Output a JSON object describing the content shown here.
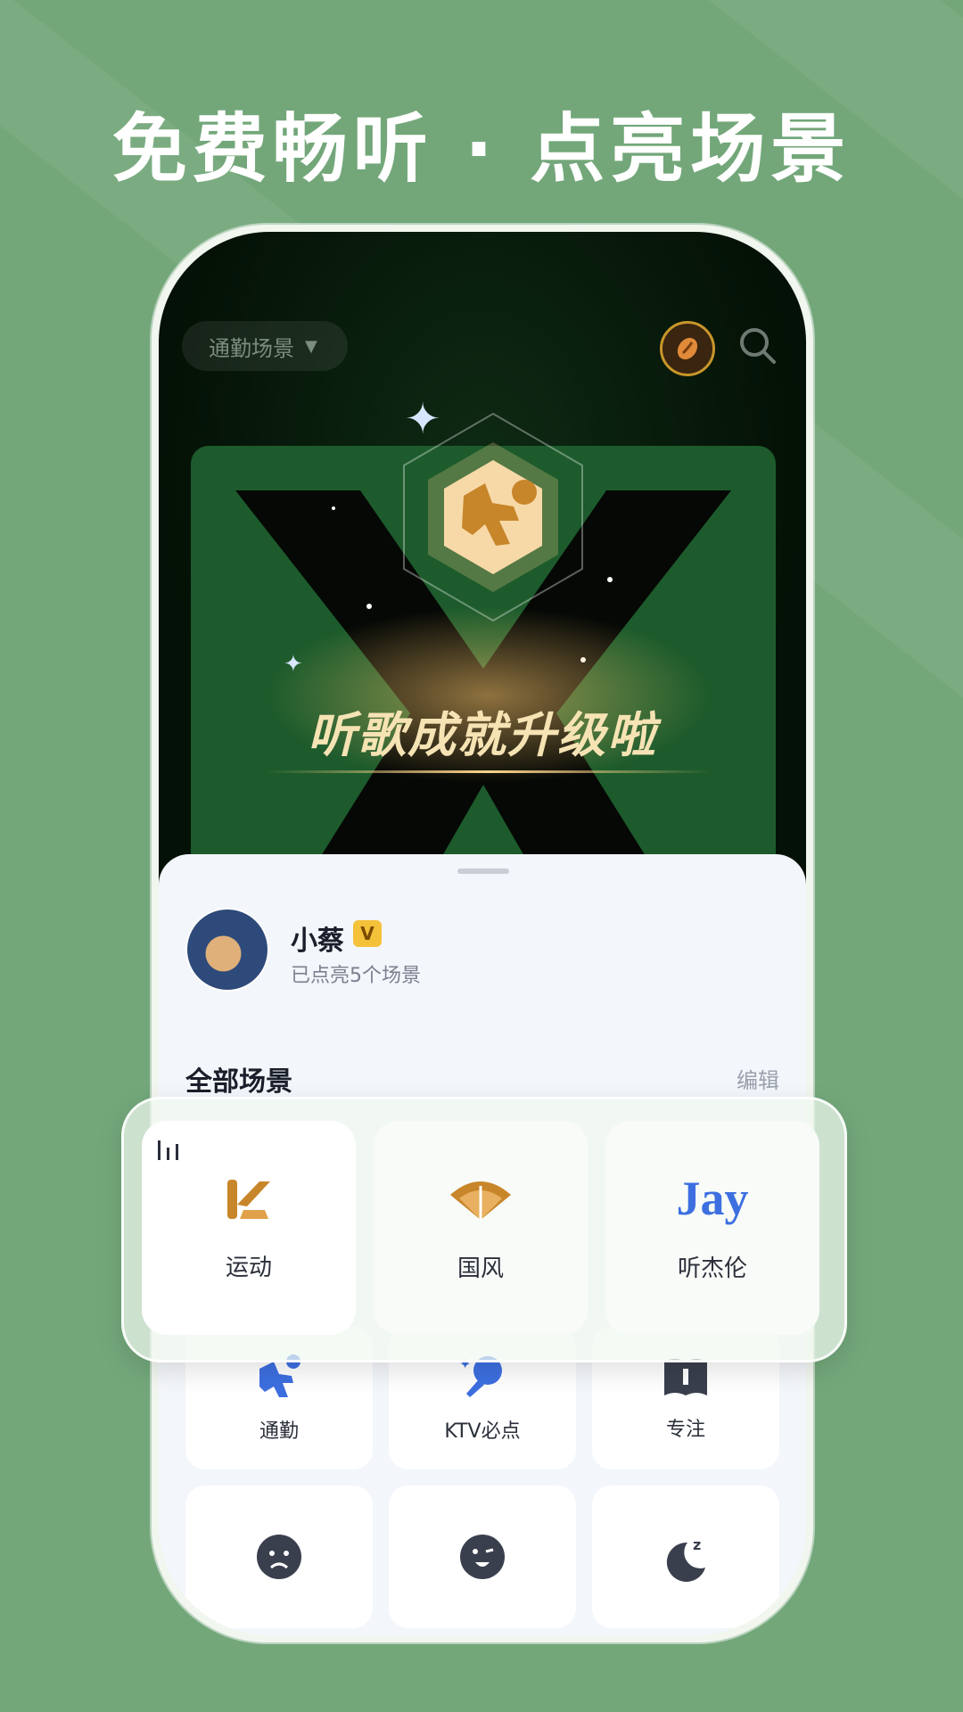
{
  "headline": "免费畅听 · 点亮场景",
  "hero": {
    "scene_chip_label": "通勤场景",
    "achievement_text": "听歌成就升级啦"
  },
  "profile": {
    "name": "小蔡",
    "vip_mark": "V",
    "subtitle": "已点亮5个场景"
  },
  "scenes": {
    "title": "全部场景",
    "edit_label": "编辑",
    "featured": [
      {
        "label": "运动",
        "icon": "k-logo-icon",
        "selected": true
      },
      {
        "label": "国风",
        "icon": "fan-icon"
      },
      {
        "label": "听杰伦",
        "icon_text": "Jay",
        "icon": "jay-logo-icon"
      }
    ],
    "grid": [
      {
        "label": "通勤",
        "icon": "runner-icon"
      },
      {
        "label": "KTV必点",
        "icon": "microphone-icon"
      },
      {
        "label": "专注",
        "icon": "book-icon"
      },
      {
        "label": "",
        "icon": "sad-face-icon"
      },
      {
        "label": "",
        "icon": "wink-face-icon"
      },
      {
        "label": "",
        "icon": "moon-sleep-icon"
      }
    ]
  },
  "colors": {
    "background": "#73a77a",
    "gold": "#c8862a",
    "blue": "#3d6fe0",
    "dark_icon": "#3a3f4d"
  }
}
